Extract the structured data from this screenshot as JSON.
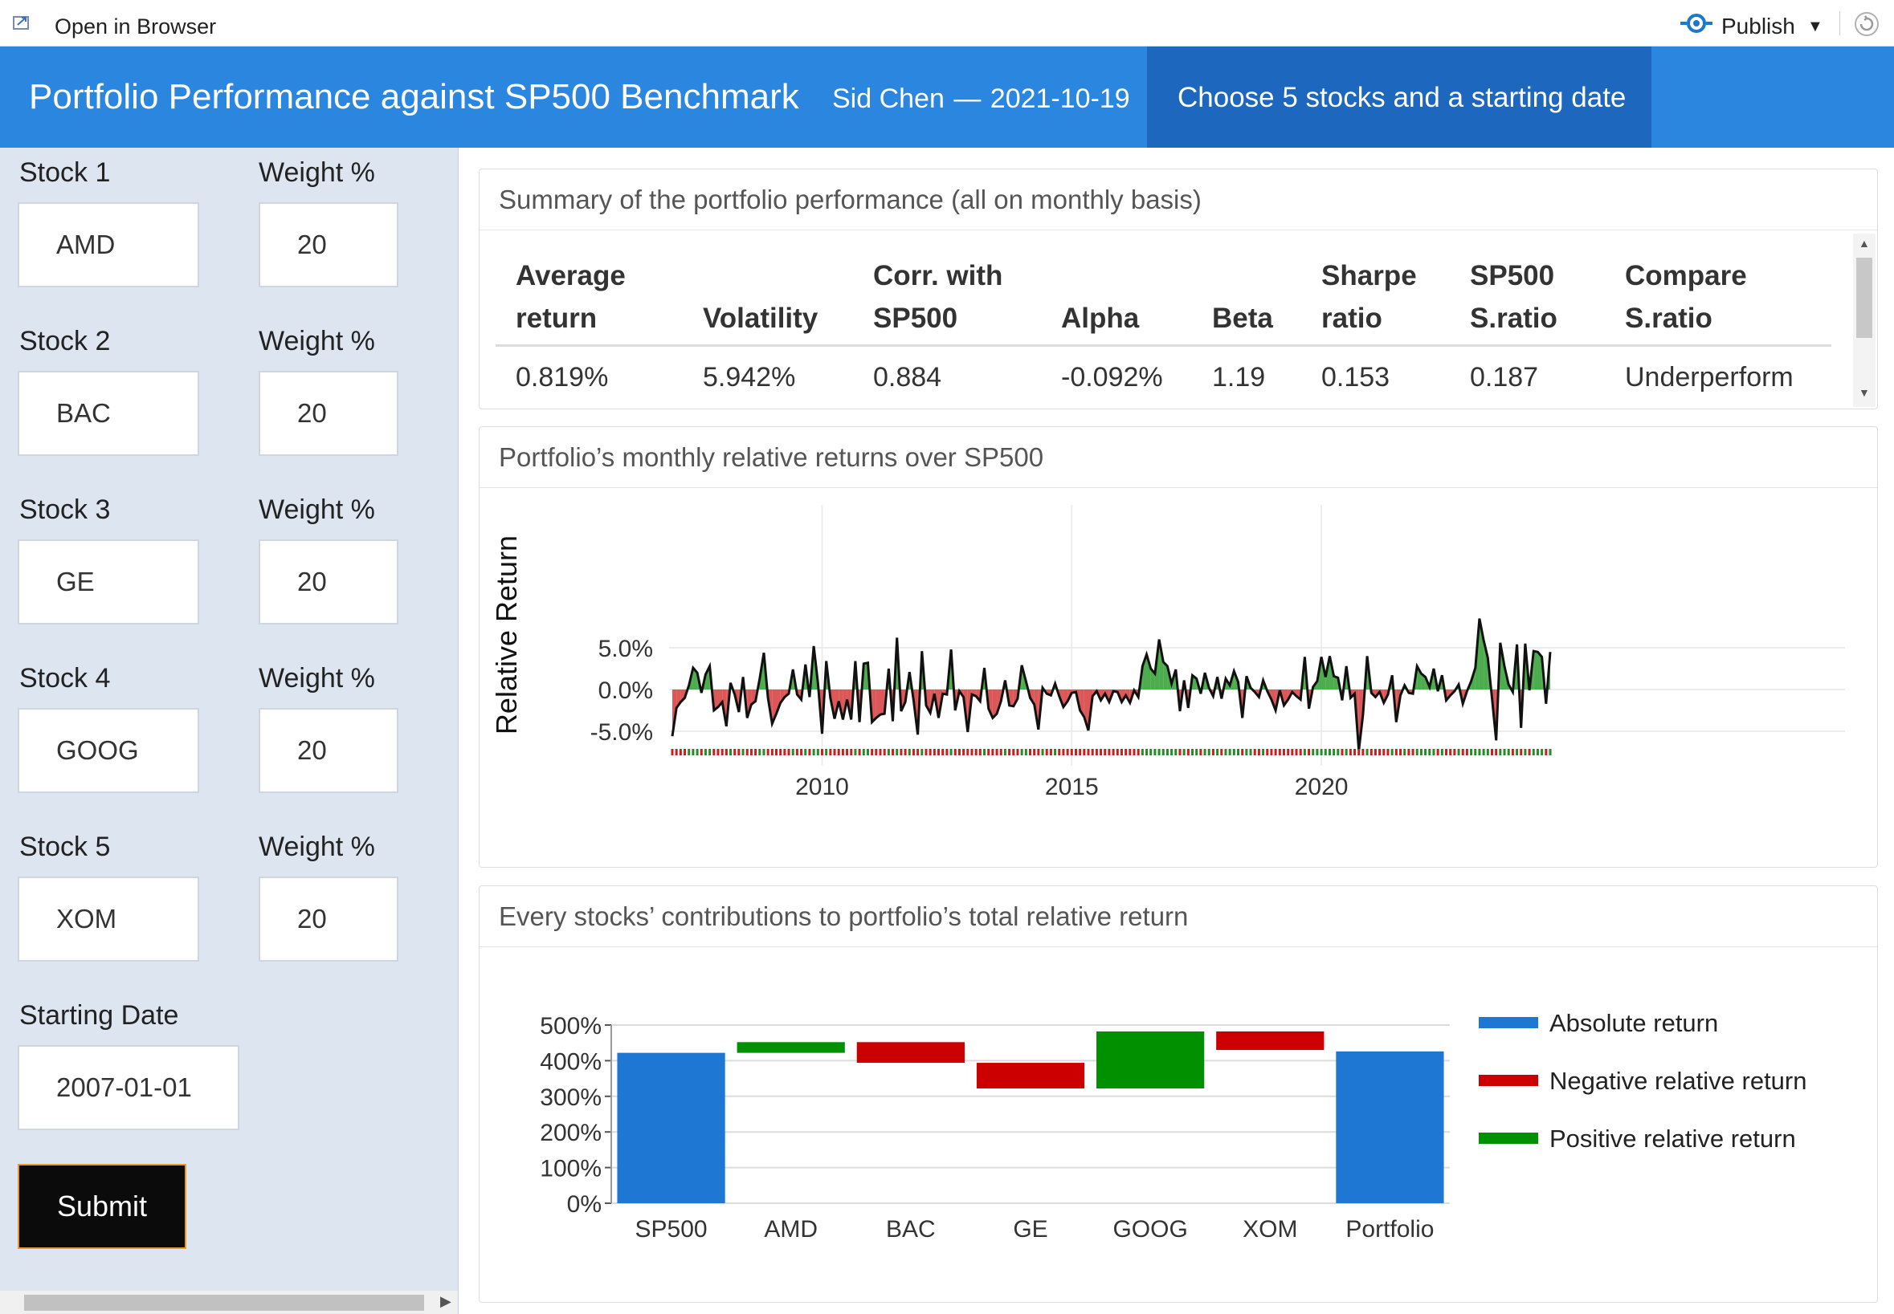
{
  "toolbar": {
    "open_in_browser": "Open in Browser",
    "publish": "Publish"
  },
  "header": {
    "title": "Portfolio Performance against SP500 Benchmark",
    "author": "Sid Chen",
    "date": "2021-10-19",
    "tab": "Choose 5 stocks and a starting date"
  },
  "sidebar": {
    "stocks": [
      {
        "stock_label": "Stock 1",
        "weight_label": "Weight %",
        "ticker": "AMD",
        "weight": "20"
      },
      {
        "stock_label": "Stock 2",
        "weight_label": "Weight %",
        "ticker": "BAC",
        "weight": "20"
      },
      {
        "stock_label": "Stock 3",
        "weight_label": "Weight %",
        "ticker": "GE",
        "weight": "20"
      },
      {
        "stock_label": "Stock 4",
        "weight_label": "Weight %",
        "ticker": "GOOG",
        "weight": "20"
      },
      {
        "stock_label": "Stock 5",
        "weight_label": "Weight %",
        "ticker": "XOM",
        "weight": "20"
      }
    ],
    "start_label": "Starting Date",
    "start_value": "2007-01-01",
    "submit": "Submit"
  },
  "summary": {
    "title": "Summary of the portfolio performance (all on monthly basis)",
    "headers": [
      [
        "Average",
        "return"
      ],
      [
        "",
        "Volatility"
      ],
      [
        "Corr. with",
        "SP500"
      ],
      [
        "",
        "Alpha"
      ],
      [
        "",
        "Beta"
      ],
      [
        "Sharpe",
        "ratio"
      ],
      [
        "SP500",
        "S.ratio"
      ],
      [
        "Compare",
        "S.ratio"
      ]
    ],
    "row": [
      "0.819%",
      "5.942%",
      "0.884",
      "-0.092%",
      "1.19",
      "0.153",
      "0.187",
      "Underperform"
    ]
  },
  "relative_chart": {
    "title": "Portfolio’s monthly relative returns over SP500",
    "ylabel": "Relative Return",
    "yticks": [
      "5.0%",
      "0.0%",
      "-5.0%"
    ],
    "xticks": [
      "2010",
      "2015",
      "2020"
    ],
    "colors": {
      "positive": "#2e9e2e",
      "negative": "#d63a3a",
      "line": "#111111"
    }
  },
  "contrib_chart": {
    "title": "Every stocks’ contributions to portfolio’s total relative return",
    "yticks": [
      "500%",
      "400%",
      "300%",
      "200%",
      "100%",
      "0%"
    ],
    "legend": [
      "Absolute return",
      "Negative relative return",
      "Positive relative return"
    ],
    "colors": {
      "absolute": "#1f77d4",
      "negative": "#cc0000",
      "positive": "#009000"
    }
  },
  "chart_data": [
    {
      "type": "area",
      "title": "Portfolio’s monthly relative returns over SP500",
      "ylabel": "Relative Return",
      "xlabel": "",
      "ylim": [
        -7.5,
        8.5
      ],
      "x_start": "2007-01",
      "x_step": "month",
      "series": [
        {
          "values": [
            -5.6,
            -2.2,
            -1.5,
            -1.0,
            0.5,
            2.6,
            2.0,
            -0.4,
            1.8,
            2.8,
            -2.5,
            -2.1,
            -1.5,
            -4.4,
            0.8,
            -0.6,
            -2.7,
            1.5,
            -3.4,
            -1.8,
            -1.4,
            1.3,
            4.4,
            -1.0,
            -4.1,
            -2.9,
            -1.6,
            -0.9,
            -0.5,
            2.4,
            -0.6,
            -1.2,
            3.0,
            -0.9,
            5.2,
            0.8,
            -5.3,
            3.4,
            -1.0,
            -3.5,
            -1.4,
            -3.6,
            -1.2,
            -3.6,
            3.4,
            -3.9,
            3.1,
            3.2,
            -3.9,
            -3.4,
            -3.0,
            -2.9,
            2.5,
            -3.8,
            6.2,
            -2.6,
            -1.5,
            2.1,
            -1.3,
            -5.4,
            4.6,
            -1.9,
            -2.8,
            -0.5,
            -3.4,
            -0.5,
            -0.6,
            4.8,
            -2.5,
            -0.2,
            -0.9,
            -5.1,
            -0.6,
            -0.8,
            -1.4,
            2.6,
            -2.3,
            -3.4,
            -2.9,
            -1.4,
            1.1,
            -1.9,
            -2.0,
            -1.1,
            2.9,
            1.0,
            -1.0,
            -1.8,
            -4.8,
            0.2,
            -0.5,
            -0.7,
            0.7,
            -0.8,
            -2.1,
            -1.4,
            -0.4,
            -0.3,
            -2.5,
            -3.3,
            -4.9,
            -0.8,
            -0.2,
            -1.3,
            -0.5,
            -1.5,
            -0.2,
            -0.3,
            -1.5,
            -0.7,
            -1.6,
            -0.1,
            -0.9,
            2.8,
            4.2,
            2.5,
            1.9,
            6.0,
            3.3,
            2.8,
            0.7,
            2.4,
            -2.6,
            1.1,
            -2.2,
            1.7,
            1.3,
            -0.5,
            2.0,
            0.2,
            -0.8,
            1.5,
            -1.1,
            1.3,
            0.5,
            2.2,
            0.9,
            -3.4,
            1.6,
            0.2,
            -0.3,
            -0.9,
            1.1,
            -0.2,
            -1.2,
            -2.5,
            -0.1,
            -1.9,
            -1.2,
            -0.3,
            -0.8,
            -1.2,
            3.9,
            -2.3,
            0.3,
            1.0,
            3.9,
            1.5,
            4.0,
            1.6,
            1.4,
            -1.3,
            2.8,
            -1.0,
            -0.5,
            -7.3,
            -3.0,
            4.0,
            -0.4,
            -0.9,
            -0.3,
            -1.6,
            -0.6,
            1.7,
            -3.9,
            -0.7,
            0.5,
            -0.4,
            -0.5,
            2.8,
            1.9,
            1.5,
            0.3,
            2.5,
            -0.2,
            1.7,
            -1.3,
            -0.7,
            -0.2,
            0.6,
            -1.7,
            -0.2,
            1.0,
            2.6,
            8.5,
            5.9,
            3.8,
            -1.0,
            -6.1,
            5.6,
            2.8,
            0.6,
            -0.3,
            5.4,
            -4.6,
            5.5,
            -0.1,
            4.6,
            4.5,
            3.9,
            -1.7,
            4.5
          ]
        }
      ]
    },
    {
      "type": "bar",
      "title": "Every stocks’ contributions to portfolio’s total relative return",
      "xlabel": "",
      "ylabel": "",
      "categories": [
        "SP500",
        "AMD",
        "BAC",
        "GE",
        "GOOG",
        "XOM",
        "Portfolio"
      ],
      "ylim": [
        0,
        500
      ],
      "bars": [
        {
          "category": "SP500",
          "kind": "absolute",
          "base": 0,
          "top": 422
        },
        {
          "category": "AMD",
          "kind": "positive",
          "base": 422,
          "top": 452
        },
        {
          "category": "BAC",
          "kind": "negative",
          "base": 452,
          "top": 394
        },
        {
          "category": "GE",
          "kind": "negative",
          "base": 394,
          "top": 322
        },
        {
          "category": "GOOG",
          "kind": "positive",
          "base": 322,
          "top": 482
        },
        {
          "category": "XOM",
          "kind": "negative",
          "base": 482,
          "top": 430
        },
        {
          "category": "Portfolio",
          "kind": "absolute",
          "base": 0,
          "top": 426
        }
      ],
      "legend": [
        "Absolute return",
        "Negative relative return",
        "Positive relative return"
      ]
    }
  ]
}
